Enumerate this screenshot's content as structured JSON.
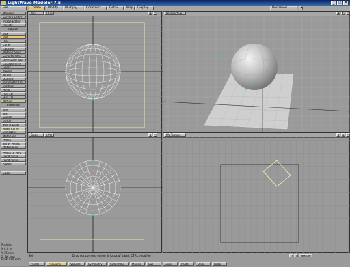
{
  "window": {
    "title": "LightWave Modeler 7.5"
  },
  "top_menu": {
    "file": "File",
    "modeler": "Modeler",
    "unnamed": "Unnamed"
  },
  "tabs": [
    "Create",
    "Modify",
    "Multiply",
    "Construct",
    "Detail",
    "Map",
    "Display"
  ],
  "sidebar": {
    "top_buttons": [
      "Surface Editor",
      "Image Editor",
      "Presets"
    ],
    "objects_header": "Objects",
    "objects": [
      "Box",
      "Ball",
      "Disc",
      "Cone",
      "Capsule",
      "Platonic Solid",
      "SuperQuadric",
      "Gemstone Tool",
      "Equilateral Tri",
      "Gears",
      "Wedge",
      "Toroid",
      "Quadric",
      "Parametric Obj",
      "Bubbles",
      "Helix",
      "Hull 3D",
      "Hull 2D"
    ],
    "selected_object": "Ball",
    "dropdown1": "Nature",
    "elements_header": "Elements",
    "elements": [
      "Key",
      "Text",
      "Sketch",
      "Bezier",
      "Spline Draw"
    ],
    "dropdown2": "Make Curve",
    "elements2": [
      "Skelegons",
      "Metaballs",
      "Points",
      "Spray Points",
      "Metaedges"
    ],
    "convert": [
      "Points to Poly",
      "RandPoints",
      "RandPoints",
      "Ripple"
    ],
    "cage": "Cage",
    "position_label": "Position",
    "position_x": "X  6.0 m",
    "position_y": "Y  75 mm",
    "position_z": "Z  -86 mm"
  },
  "viewports": {
    "top": {
      "label": "Top",
      "mode": "(XZ)"
    },
    "perspective": {
      "label": "Perspective"
    },
    "back": {
      "label": "Back",
      "mode": "(XY)"
    },
    "uv": {
      "label": "UV Texture"
    }
  },
  "status": {
    "grid": "Grid:",
    "grid_val": "500 mm",
    "sel": "Sel:",
    "message": "Drag out corners, center is focus of a ball; CTRL: modifier",
    "modes": [
      "Points",
      "Polygons",
      "Volume",
      "Symmetry",
      "CutomObj",
      "Modes",
      "Cut",
      "Copy",
      "Paste",
      "Undo",
      "Redo"
    ],
    "texture_label": "Texture",
    "texture_mode": "T"
  },
  "colors": {
    "accent": "#f0c870",
    "selected_wire": "#e8e8b0",
    "point": "#40c0c0"
  }
}
